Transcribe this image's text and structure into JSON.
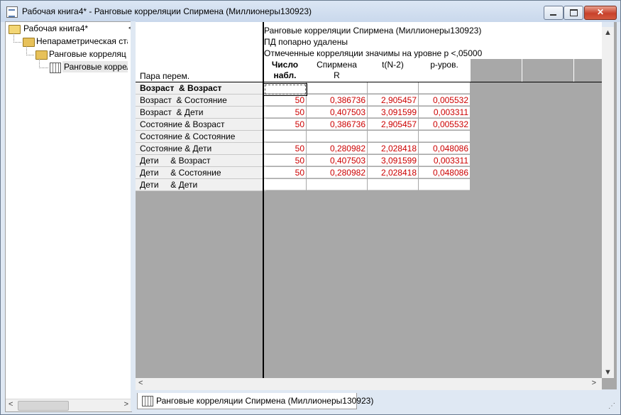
{
  "window": {
    "title": "Рабочая книга4* - Ранговые корреляции Спирмена (Миллионеры130923)",
    "minimize_glyph": "",
    "maximize_glyph": "",
    "close_glyph": "✕"
  },
  "tree": {
    "items": [
      {
        "label": "Рабочая книга4*"
      },
      {
        "label": "Непараметрическая ста"
      },
      {
        "label": "Ранговые корреляц"
      },
      {
        "label": "Ранговые корреля"
      }
    ],
    "collapse_glyph": "<",
    "scroll_left": "<",
    "scroll_right": ">"
  },
  "spreadsheet": {
    "header_lines": [
      "Ранговые корреляции Спирмена (Миллионеры130923)",
      "ПД попарно удалены",
      "Отмеченные корреляции значимы на уровне p <,05000"
    ],
    "pair_column_header": "Пара перем.",
    "columns": [
      {
        "line1": "Число",
        "line2": "набл.",
        "bold": true
      },
      {
        "line1": "Спирмена",
        "line2": "R",
        "bold": false
      },
      {
        "line1": "t(N-2)",
        "line2": "",
        "bold": false
      },
      {
        "line1": "p-уров.",
        "line2": "",
        "bold": false
      }
    ],
    "rows": [
      {
        "label": "Возраст  & Возраст",
        "bold": true,
        "values": [
          "",
          "",
          "",
          ""
        ]
      },
      {
        "label": "Возраст  & Состояние",
        "bold": false,
        "values": [
          "50",
          "0,386736",
          "2,905457",
          "0,005532"
        ]
      },
      {
        "label": "Возраст  & Дети",
        "bold": false,
        "values": [
          "50",
          "0,407503",
          "3,091599",
          "0,003311"
        ]
      },
      {
        "label": "Состояние & Возраст",
        "bold": false,
        "values": [
          "50",
          "0,386736",
          "2,905457",
          "0,005532"
        ]
      },
      {
        "label": "Состояние & Состояние",
        "bold": false,
        "values": [
          "",
          "",
          "",
          ""
        ]
      },
      {
        "label": "Состояние & Дети",
        "bold": false,
        "values": [
          "50",
          "0,280982",
          "2,028418",
          "0,048086"
        ]
      },
      {
        "label": "Дети     & Возраст",
        "bold": false,
        "values": [
          "50",
          "0,407503",
          "3,091599",
          "0,003311"
        ]
      },
      {
        "label": "Дети     & Состояние",
        "bold": false,
        "values": [
          "50",
          "0,280982",
          "2,028418",
          "0,048086"
        ]
      },
      {
        "label": "Дети     & Дети",
        "bold": false,
        "values": [
          "",
          "",
          "",
          ""
        ]
      }
    ],
    "value_color": "#cc0000",
    "empty_area_color": "#a8a8a8",
    "scroll_up": "▲",
    "scroll_down": "▼",
    "scroll_left": "<",
    "scroll_right": ">"
  },
  "sheet_tab": {
    "label": "Ранговые корреляции Спирмена (Миллионеры130923)"
  }
}
